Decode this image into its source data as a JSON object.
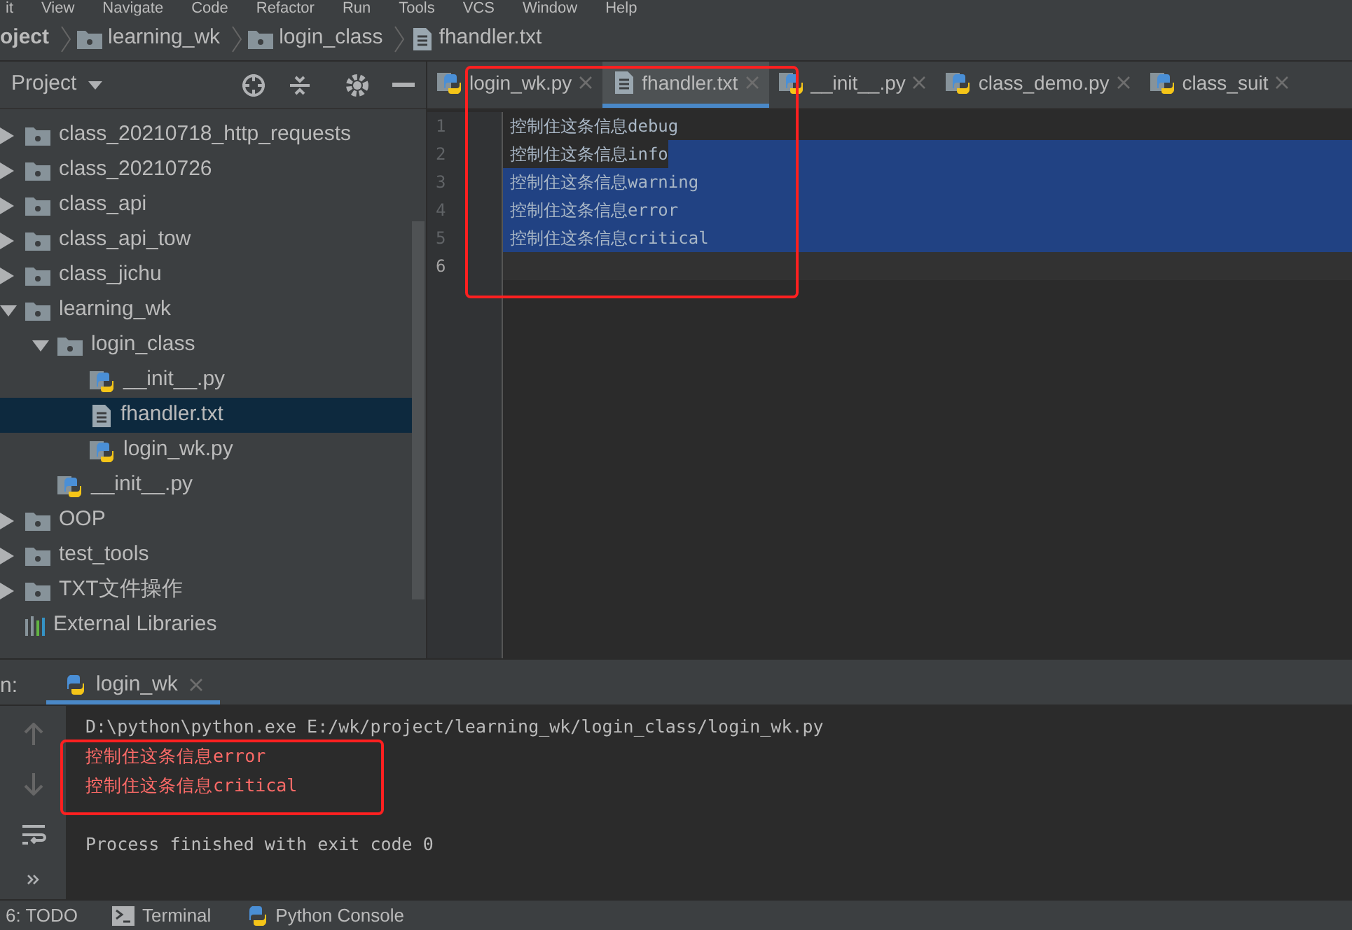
{
  "menu": [
    "it",
    "View",
    "Navigate",
    "Code",
    "Refactor",
    "Run",
    "Tools",
    "VCS",
    "Window",
    "Help"
  ],
  "breadcrumb": [
    {
      "label": "oject",
      "kind": "project"
    },
    {
      "label": "learning_wk",
      "kind": "folder"
    },
    {
      "label": "login_class",
      "kind": "folder"
    },
    {
      "label": "fhandler.txt",
      "kind": "text"
    }
  ],
  "project_panel": {
    "title": "Project"
  },
  "tree": [
    {
      "label": "class_20210718_http_requests",
      "kind": "folder",
      "expanded": false,
      "selected": false
    },
    {
      "label": "class_20210726",
      "kind": "folder",
      "expanded": false,
      "selected": false
    },
    {
      "label": "class_api",
      "kind": "folder",
      "expanded": false,
      "selected": false
    },
    {
      "label": "class_api_tow",
      "kind": "folder",
      "expanded": false,
      "selected": false
    },
    {
      "label": "class_jichu",
      "kind": "folder",
      "expanded": false,
      "selected": false
    },
    {
      "label": "learning_wk",
      "kind": "folder",
      "expanded": true,
      "selected": false,
      "children": [
        {
          "label": "login_class",
          "kind": "folder",
          "expanded": true,
          "selected": false,
          "children": [
            {
              "label": "__init__.py",
              "kind": "python",
              "selected": false
            },
            {
              "label": "fhandler.txt",
              "kind": "text",
              "selected": true
            },
            {
              "label": "login_wk.py",
              "kind": "python",
              "selected": false
            }
          ]
        },
        {
          "label": "__init__.py",
          "kind": "python",
          "selected": false
        }
      ]
    },
    {
      "label": "OOP",
      "kind": "folder",
      "expanded": false,
      "selected": false
    },
    {
      "label": "test_tools",
      "kind": "folder",
      "expanded": false,
      "selected": false
    },
    {
      "label": "TXT文件操作",
      "kind": "folder",
      "expanded": false,
      "selected": false
    },
    {
      "label": "External Libraries",
      "kind": "library",
      "selected": false
    }
  ],
  "tabs": [
    {
      "label": "login_wk.py",
      "kind": "python",
      "selected": false
    },
    {
      "label": "fhandler.txt",
      "kind": "text",
      "selected": true
    },
    {
      "label": "__init__.py",
      "kind": "python",
      "selected": false
    },
    {
      "label": "class_demo.py",
      "kind": "python",
      "selected": false
    },
    {
      "label": "class_suit",
      "kind": "python",
      "selected": false
    }
  ],
  "editor_lines": [
    {
      "number": "1",
      "text": "控制住这条信息debug",
      "selected": false,
      "selected_after_text": false,
      "current": false
    },
    {
      "number": "2",
      "text": "控制住这条信息info",
      "selected": false,
      "selected_after_text": true,
      "current": false
    },
    {
      "number": "3",
      "text": "控制住这条信息warning",
      "selected": true,
      "selected_after_text": false,
      "current": false
    },
    {
      "number": "4",
      "text": "控制住这条信息error",
      "selected": true,
      "selected_after_text": false,
      "current": false
    },
    {
      "number": "5",
      "text": "控制住这条信息critical",
      "selected": true,
      "selected_after_text": false,
      "current": false
    },
    {
      "number": "6",
      "selected": false,
      "selected_after_text": false,
      "current": true
    }
  ],
  "run_panel": {
    "label": "n:",
    "tab": "login_wk"
  },
  "console": [
    {
      "text": "D:\\python\\python.exe E:/wk/project/learning_wk/login_class/login_wk.py",
      "kind": "command"
    },
    {
      "text": "控制住这条信息error",
      "kind": "error"
    },
    {
      "text": "控制住这条信息critical",
      "kind": "error"
    },
    {
      "kind": "blank"
    },
    {
      "text": "Process finished with exit code 0",
      "kind": "info"
    }
  ],
  "bottom_tabs": [
    {
      "label": "6: TODO",
      "kind": "todo"
    },
    {
      "label": "Terminal",
      "kind": "terminal"
    },
    {
      "label": "Python Console",
      "kind": "python"
    }
  ]
}
